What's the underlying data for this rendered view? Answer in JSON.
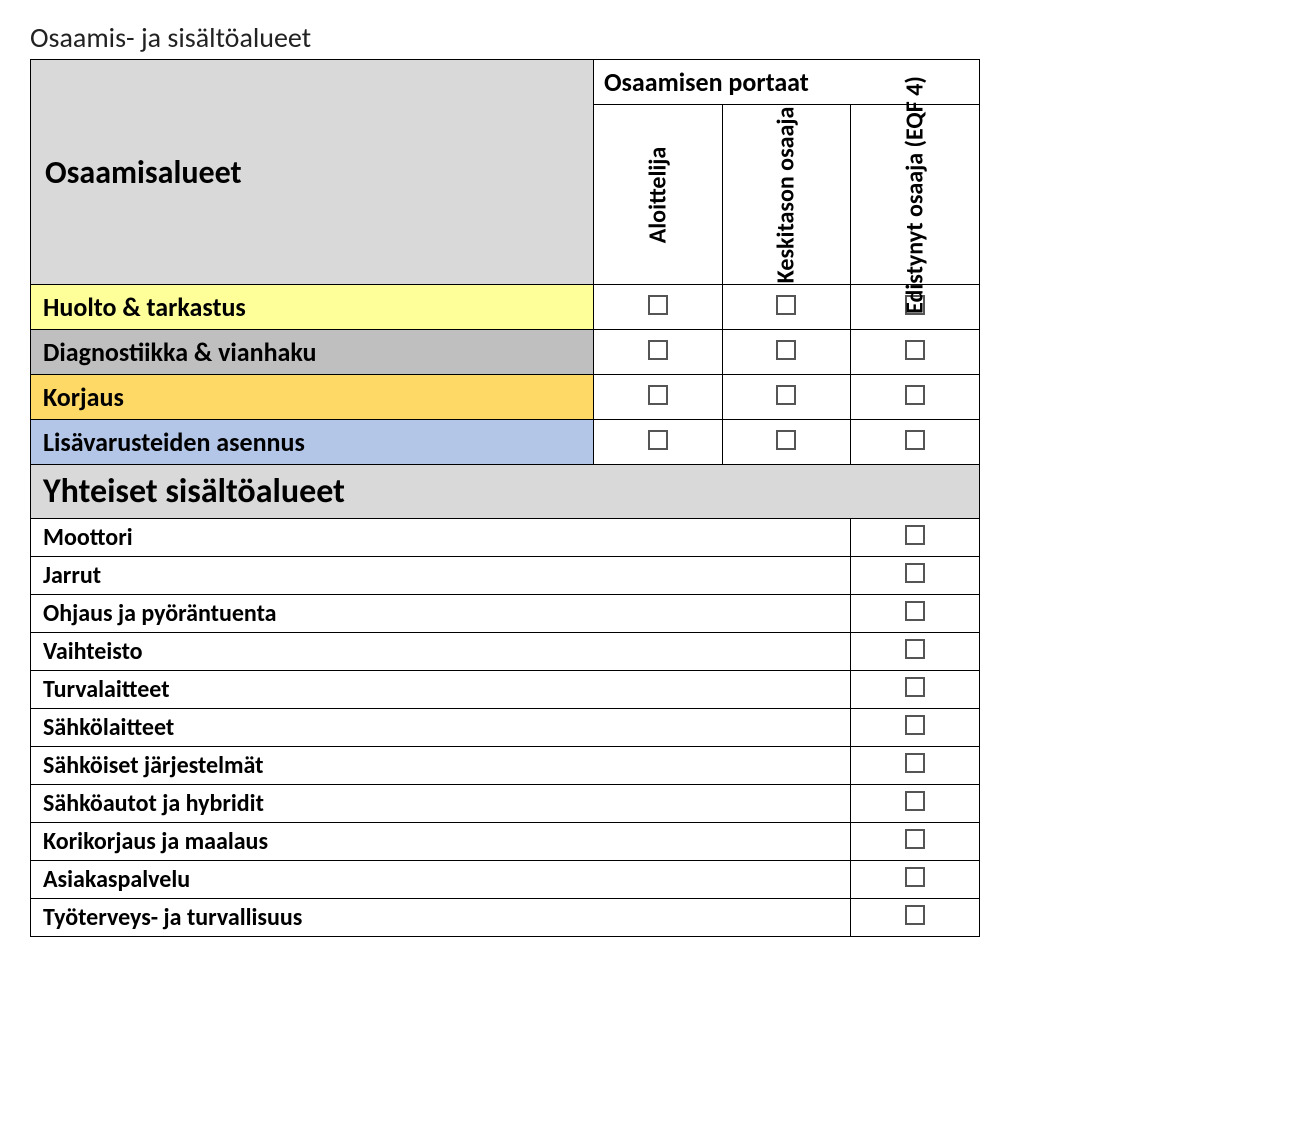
{
  "page_title": "Osaamis- ja sisältöalueet",
  "headers": {
    "main": "Osaamisalueet",
    "group": "Osaamisen portaat",
    "col1": "Aloittelija",
    "col2": "Keskitason osaaja",
    "col3": "Edistynyt osaaja (EQF 4)"
  },
  "competence_rows": [
    {
      "label": "Huolto & tarkastus",
      "bg": "bg-yellow"
    },
    {
      "label": "Diagnostiikka & vianhaku",
      "bg": "bg-grey"
    },
    {
      "label": "Korjaus",
      "bg": "bg-orange"
    },
    {
      "label": "Lisävarusteiden asennus",
      "bg": "bg-blue"
    }
  ],
  "section_title": "Yhteiset sisältöalueet",
  "content_rows": [
    "Moottori",
    "Jarrut",
    "Ohjaus ja pyöräntuenta",
    "Vaihteisto",
    "Turvalaitteet",
    "Sähkölaitteet",
    "Sähköiset järjestelmät",
    "Sähköautot ja hybridit",
    "Korikorjaus ja maalaus",
    "Asiakaspalvelu",
    "Työterveys- ja turvallisuus"
  ]
}
